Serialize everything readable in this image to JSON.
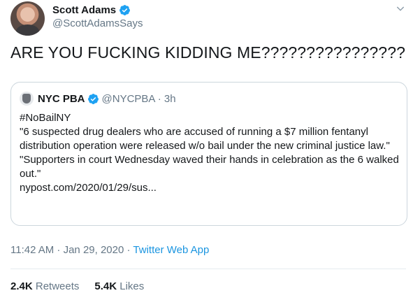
{
  "tweet": {
    "author_name": "Scott Adams",
    "handle": "@ScottAdamsSays",
    "text": "ARE YOU FUCKING KIDDING ME????????????????",
    "icons": {
      "verified": "verified-badge-icon",
      "menu": "chevron-down-icon"
    },
    "timestamp": "11:42 AM · Jan 29, 2020",
    "separator": " · ",
    "source": "Twitter Web App",
    "retweets_count": "2.4K",
    "retweets_label": "Retweets",
    "likes_count": "5.4K",
    "likes_label": "Likes"
  },
  "quoted": {
    "author_name": "NYC PBA",
    "handle": "@NYCPBA · 3h",
    "hashtag": "#NoBailNY",
    "para1": "\"6 suspected drug dealers who are accused of running a $7 million fentanyl distribution operation were released w/o bail under the new criminal justice law.\"",
    "para2": "\"Supporters in court Wednesday waved their hands in celebration as the 6 walked out.\"",
    "link": "nypost.com/2020/01/29/sus..."
  },
  "colors": {
    "accent": "#1b95e0",
    "text": "#14171a",
    "secondary": "#657786",
    "border": "#ccd6dd"
  }
}
